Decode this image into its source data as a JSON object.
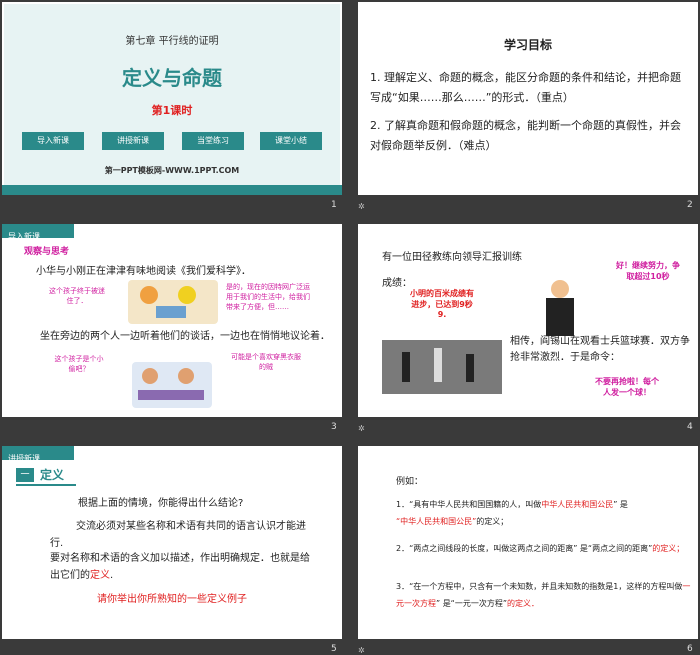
{
  "slides": [
    {
      "number": "1",
      "chapter": "第七章  平行线的证明",
      "title": "定义与命题",
      "lesson": "第1课时",
      "nav": [
        "导入新课",
        "讲授新课",
        "当堂练习",
        "课堂小结"
      ],
      "footer": "第一PPT模板网-WWW.1PPT.COM"
    },
    {
      "number": "2",
      "heading": "学习目标",
      "item1": "1. 理解定义、命题的概念，能区分命题的条件和结论，并把命题写成“如果……那么……”的形式．（重点）",
      "item2": "2. 了解真命题和假命题的概念，能判断一个命题的真假性，并会对假命题举反例．（难点）"
    },
    {
      "number": "3",
      "tag": "导入新课",
      "subtag": "观察与思考",
      "para1": "小华与小刚正在津津有味地阅读《我们爱科学》．",
      "para2": "坐在旁边的两个人一边听着他们的谈话，一边也在悄悄地议论着．",
      "bubble1": "这个孩子终于被迷住了．",
      "bubble2": "是的，现在的因特网广泛运用于我们的生活中，给我们带来了方便，但……",
      "bubble3": "这个孩子是个小偷吧？",
      "bubble4": "可能是个喜欢穿黑衣服的贼"
    },
    {
      "number": "4",
      "line1": "有一位田径教练向领导汇报训练",
      "line2": "成绩：",
      "red1": "小明的百米成绩有进步，已达到9秒9.",
      "red2": "好！继续努力，争取超过10秒",
      "para": "相传，阎锡山在观看士兵篮球赛．双方争抢非常激烈．于是命令：",
      "red3": "不要再抢啦！每个人发一个球！"
    },
    {
      "number": "5",
      "tag": "讲授新课",
      "section_num": "一",
      "section_title": "定义",
      "q": "根据上面的情境，你能得出什么结论?",
      "p1": "交流必须对某些名称和术语有共同的语言认识才能进行.",
      "p2a": "要对名称和术语的含义加以描述，作出明确规定．也就是给出它们的",
      "p2b": "定义",
      "prompt": "请你举出你所熟知的一些定义例子"
    },
    {
      "number": "6",
      "heading": "例如：",
      "e1a": "1．“具有中华人民共和国国籍的人，叫做",
      "e1b": "中华人民共和国公民",
      "e1c": "”  是",
      "e1d": "“中华人民共和国公民”",
      "e1e": "的定义；",
      "e2a": "2．“两点之间线段的长度，叫做这两点之间的距离”  是“两点之间的距离”",
      "e2b": "的定义；",
      "e3a": "3．“在一个方程中，只含有一个未知数，并且未知数的指数是1，这样的方程叫做",
      "e3b": "一元一次方程",
      "e3c": "”  是“一元一次方程”",
      "e3d": "的定义．"
    }
  ],
  "colors": {
    "teal": "#2a8a8a",
    "red": "#e02020",
    "magenta": "#d020a0"
  }
}
